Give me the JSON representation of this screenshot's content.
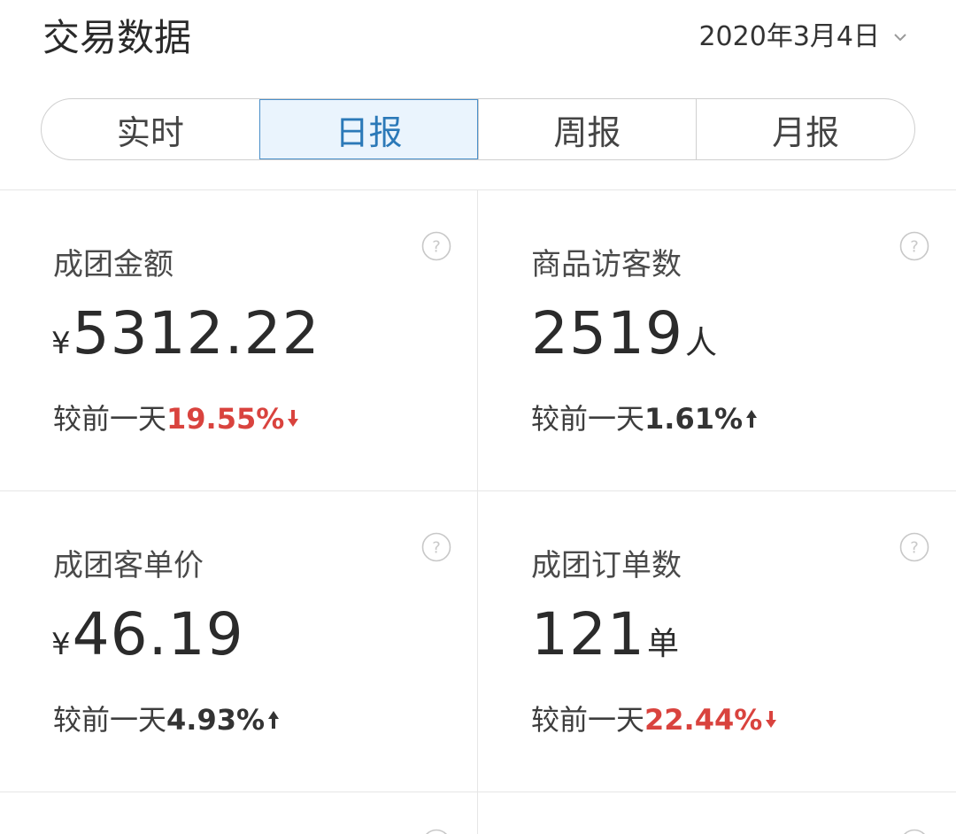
{
  "header": {
    "title": "交易数据",
    "date": "2020年3月4日"
  },
  "tabs": [
    {
      "label": "实时",
      "active": false
    },
    {
      "label": "日报",
      "active": true
    },
    {
      "label": "周报",
      "active": false
    },
    {
      "label": "月报",
      "active": false
    }
  ],
  "colors": {
    "accent": "#2b79b8",
    "down": "#d9433e",
    "up": "#333333"
  },
  "cards": [
    {
      "label": "成团金额",
      "currency": "¥",
      "value": "5312.22",
      "unit": "",
      "compare_label": "较前一天",
      "change": "19.55%",
      "direction": "down"
    },
    {
      "label": "商品访客数",
      "currency": "",
      "value": "2519",
      "unit": "人",
      "compare_label": "较前一天",
      "change": "1.61%",
      "direction": "up"
    },
    {
      "label": "成团客单价",
      "currency": "¥",
      "value": "46.19",
      "unit": "",
      "compare_label": "较前一天",
      "change": "4.93%",
      "direction": "up"
    },
    {
      "label": "成团订单数",
      "currency": "",
      "value": "121",
      "unit": "单",
      "compare_label": "较前一天",
      "change": "22.44%",
      "direction": "down"
    }
  ]
}
